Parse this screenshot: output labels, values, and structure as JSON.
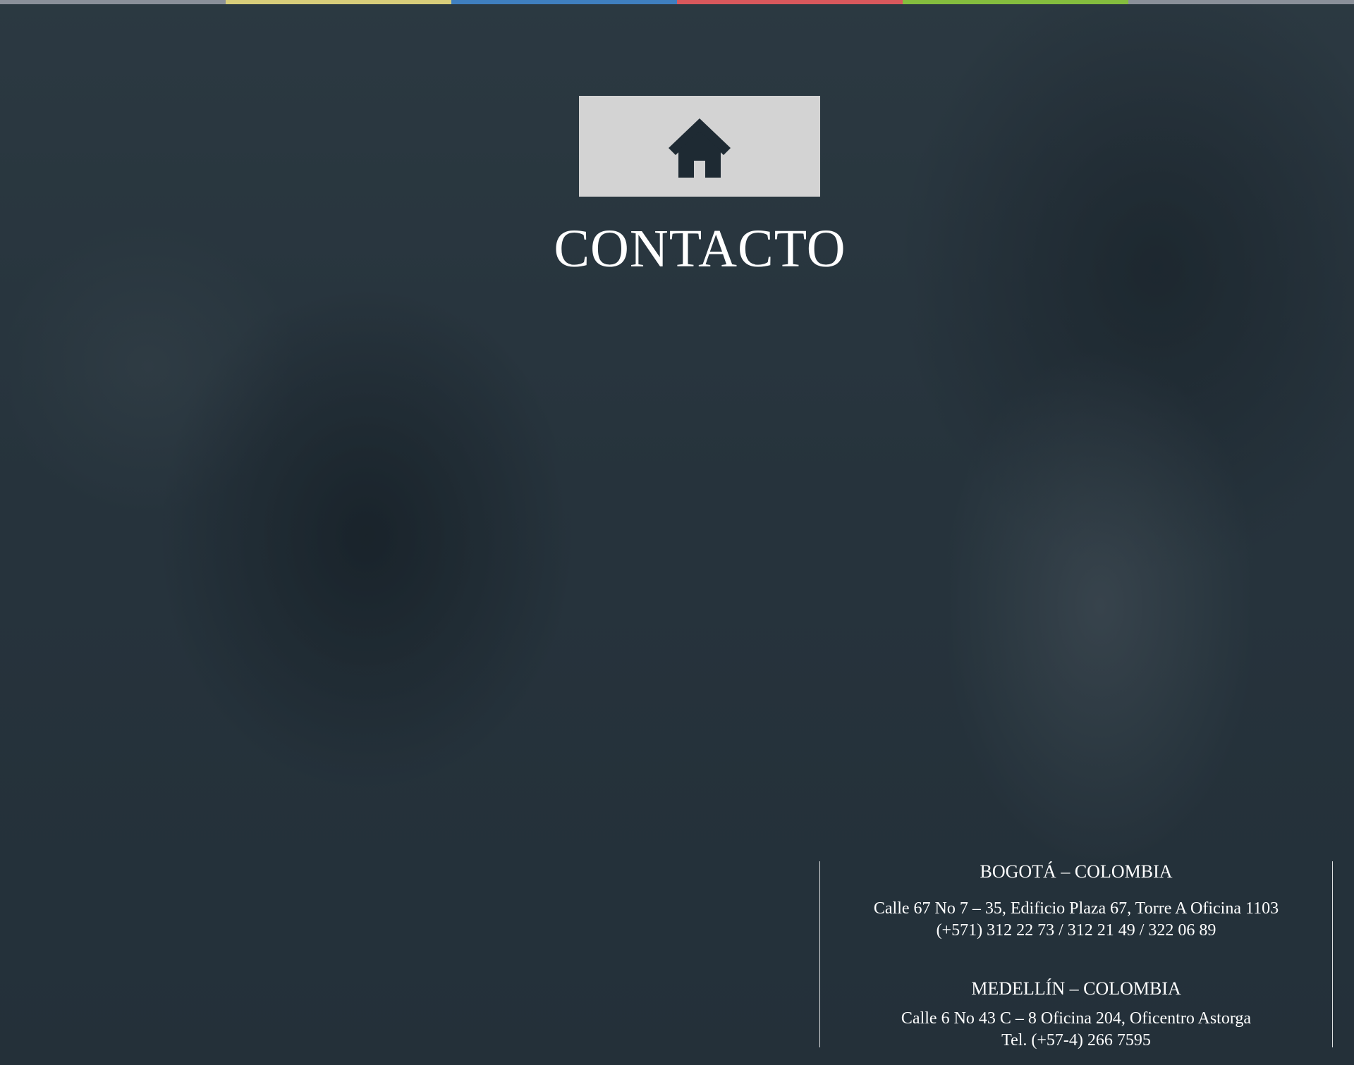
{
  "page": {
    "title": "CONTACTO"
  },
  "top_stripe": {
    "colors": [
      "#8a9099",
      "#d8cd7a",
      "#3f7fbf",
      "#d9585c",
      "#84bd3e",
      "#8a9099"
    ]
  },
  "home_button": {
    "icon": "home-icon",
    "background": "#d3d3d3",
    "icon_color": "#1e2a33"
  },
  "offices": [
    {
      "title": "BOGOTÁ – COLOMBIA",
      "address": "Calle 67 No 7 – 35, Edificio Plaza 67, Torre A Oficina 1103",
      "phone": "(+571) 312 22 73 / 312 21 49 / 322 06 89"
    },
    {
      "title": "MEDELLÍN – COLOMBIA",
      "address": "Calle 6 No 43 C – 8 Oficina 204, Oficentro Astorga",
      "phone": "Tel. (+57-4) 266 7595"
    }
  ]
}
